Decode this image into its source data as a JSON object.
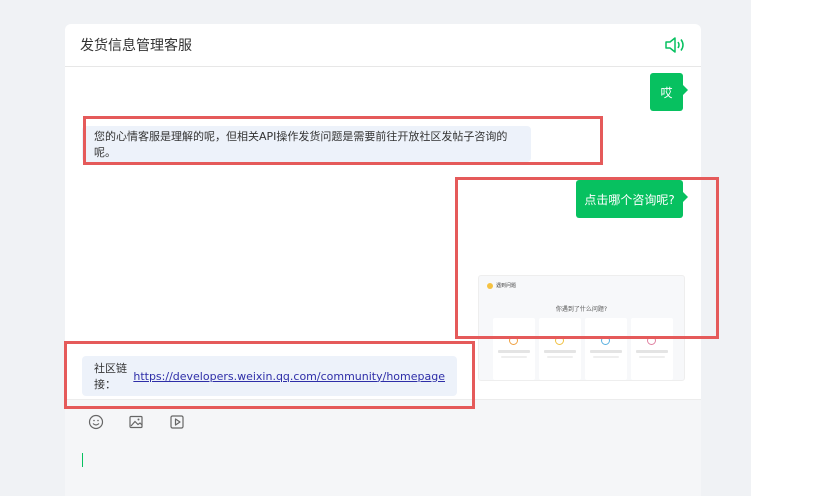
{
  "header": {
    "title": "发货信息管理客服",
    "icon": "speaker-icon"
  },
  "messages": {
    "user_1": "哎",
    "bot_1": "您的心情客服是理解的呢，但相关API操作发货问题是需要前往开放社区发帖子咨询的呢。",
    "user_2": "点击哪个咨询呢?",
    "image": {
      "header": "遇到问题",
      "question": "你遇到了什么问题?",
      "cards": [
        "API",
        "小程序",
        "插件",
        "开发者"
      ]
    },
    "bot_2": {
      "prefix": "社区链接：",
      "link": "https://developers.weixin.qq.com/community/homepage"
    }
  },
  "toolbar": {
    "icons": [
      "emoji-icon",
      "image-icon",
      "video-icon"
    ]
  },
  "colors": {
    "accent": "#07c160",
    "highlight": "#e55a5a",
    "link": "#2e2ea8",
    "bot_bubble": "#edf2fa"
  }
}
